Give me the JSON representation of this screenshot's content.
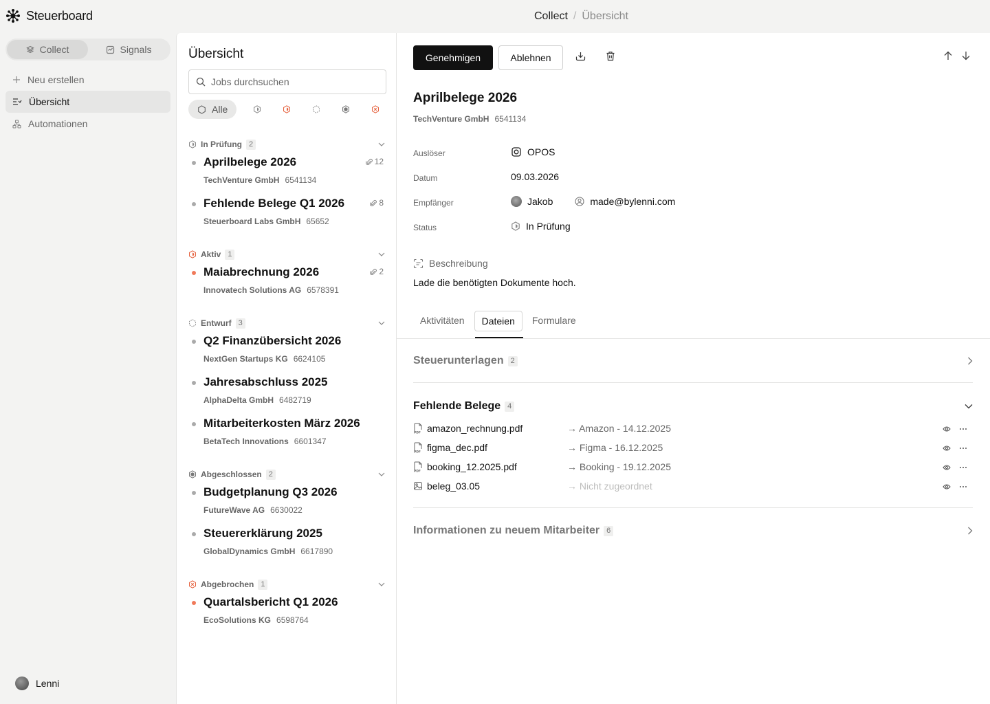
{
  "app": {
    "name": "Steuerboard"
  },
  "breadcrumb": {
    "section": "Collect",
    "separator": "/",
    "page": "Übersicht"
  },
  "sidebar": {
    "switch": [
      {
        "label": "Collect",
        "icon": "stack-icon",
        "active": true
      },
      {
        "label": "Signals",
        "icon": "chart-check-icon",
        "active": false
      }
    ],
    "nav": [
      {
        "label": "Neu erstellen",
        "icon": "plus-icon"
      },
      {
        "label": "Übersicht",
        "icon": "list-filter-icon",
        "active": true
      },
      {
        "label": "Automationen",
        "icon": "workflow-icon"
      }
    ],
    "user": {
      "name": "Lenni"
    }
  },
  "list": {
    "title": "Übersicht",
    "search_placeholder": "Jobs durchsuchen",
    "filter_all": "Alle",
    "groups": [
      {
        "label": "In Prüfung",
        "count": "2",
        "icon": "review-status-icon",
        "items": [
          {
            "title": "Aprilbelege 2026",
            "company": "TechVenture GmbH",
            "id": "6541134",
            "attachments": "12"
          },
          {
            "title": "Fehlende Belege Q1 2026",
            "company": "Steuerboard Labs GmbH",
            "id": "65652",
            "attachments": "8"
          }
        ]
      },
      {
        "label": "Aktiv",
        "count": "1",
        "icon": "active-status-icon",
        "items": [
          {
            "title": "Maiabrechnung 2026",
            "company": "Innovatech Solutions AG",
            "id": "6578391",
            "attachments": "2"
          }
        ]
      },
      {
        "label": "Entwurf",
        "count": "3",
        "icon": "draft-status-icon",
        "items": [
          {
            "title": "Q2 Finanzübersicht 2026",
            "company": "NextGen Startups KG",
            "id": "6624105"
          },
          {
            "title": "Jahresabschluss 2025",
            "company": "AlphaDelta GmbH",
            "id": "6482719"
          },
          {
            "title": "Mitarbeiterkosten März 2026",
            "company": "BetaTech Innovations",
            "id": "6601347"
          }
        ]
      },
      {
        "label": "Abgeschlossen",
        "count": "2",
        "icon": "completed-status-icon",
        "items": [
          {
            "title": "Budgetplanung Q3 2026",
            "company": "FutureWave AG",
            "id": "6630022"
          },
          {
            "title": "Steuererklärung 2025",
            "company": "GlobalDynamics GmbH",
            "id": "6617890"
          }
        ]
      },
      {
        "label": "Abgebrochen",
        "count": "1",
        "icon": "cancelled-status-icon",
        "items": [
          {
            "title": "Quartalsbericht Q1 2026",
            "company": "EcoSolutions KG",
            "id": "6598764"
          }
        ]
      }
    ]
  },
  "detail": {
    "approve_label": "Genehmigen",
    "reject_label": "Ablehnen",
    "title": "Aprilbelege 2026",
    "company": "TechVenture GmbH",
    "id": "6541134",
    "properties": {
      "trigger_label": "Auslöser",
      "trigger_value": "OPOS",
      "date_label": "Datum",
      "date_value": "09.03.2026",
      "recipient_label": "Empfänger",
      "recipient_name": "Jakob",
      "recipient_email": "made@bylenni.com",
      "status_label": "Status",
      "status_value": "In Prüfung"
    },
    "description_label": "Beschreibung",
    "description": "Lade die benötigten Dokumente hoch.",
    "tabs": [
      "Aktivitäten",
      "Dateien",
      "Formulare"
    ],
    "active_tab": "Dateien",
    "sections": [
      {
        "title": "Steuerunterlagen",
        "count": "2",
        "expanded": false
      },
      {
        "title": "Fehlende Belege",
        "count": "4",
        "expanded": true,
        "files": [
          {
            "name": "amazon_rechnung.pdf",
            "type": "pdf-file-icon",
            "mapping": "Amazon - 14.12.2025"
          },
          {
            "name": "figma_dec.pdf",
            "type": "pdf-file-icon",
            "mapping": "Figma - 16.12.2025"
          },
          {
            "name": "booking_12.2025.pdf",
            "type": "pdf-file-icon",
            "mapping": "Booking - 19.12.2025"
          },
          {
            "name": "beleg_03.05",
            "type": "image-file-icon",
            "mapping": "Nicht zugeordnet"
          }
        ]
      },
      {
        "title": "Informationen zu neuem Mitarbeiter",
        "count": "6",
        "expanded": false
      }
    ]
  }
}
